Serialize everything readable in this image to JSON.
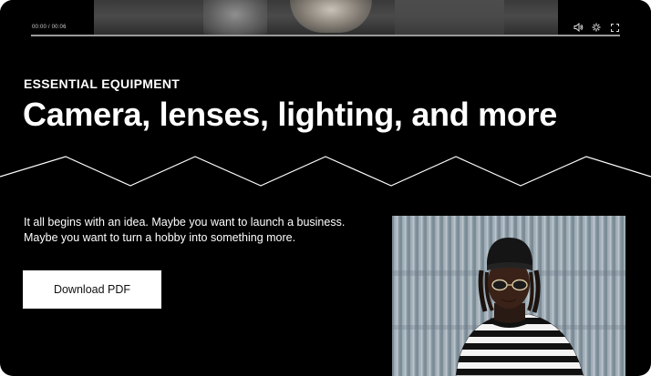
{
  "video": {
    "time": "00:00 / 00:06",
    "progress_fraction": 0.0,
    "controls": [
      "volume-icon",
      "settings-icon",
      "fullscreen-icon"
    ]
  },
  "section": {
    "eyebrow": "ESSENTIAL EQUIPMENT",
    "title": "Camera, lenses, lighting, and more",
    "intro_line1": "It all begins with an idea. Maybe you want to launch a business.",
    "intro_line2": "Maybe you want to turn a hobby into something more.",
    "cta_label": "Download PDF"
  },
  "colors": {
    "background": "#000000",
    "text": "#ffffff",
    "button_bg": "#ffffff",
    "button_text": "#111111"
  }
}
